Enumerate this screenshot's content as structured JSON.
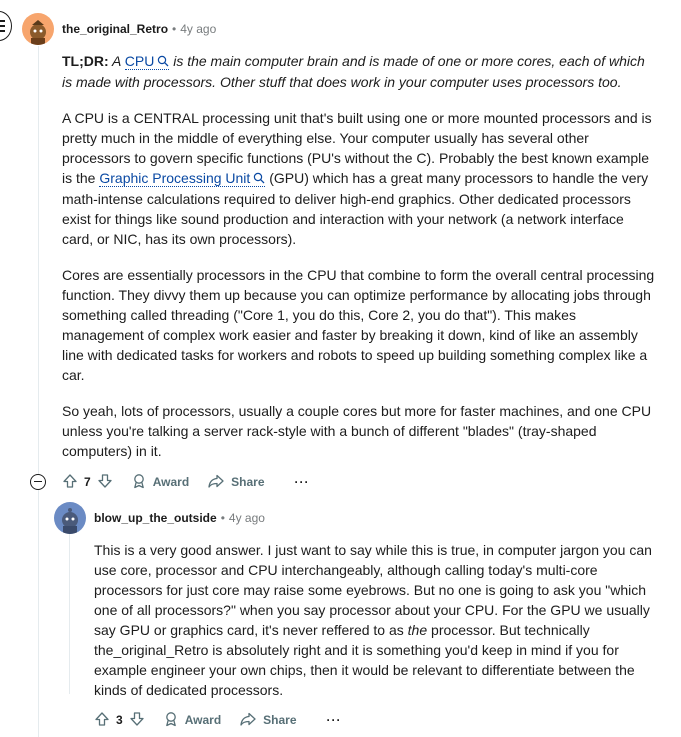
{
  "comment1": {
    "username": "the_original_Retro",
    "separator": "•",
    "age": "4y ago",
    "tldr_label": "TL;DR:",
    "tldr_pre": "A ",
    "tldr_keyword": "CPU",
    "tldr_post": " is the main computer brain and is made of one or more cores, each of which is made with processors. Other stuff that does work in your computer uses processors too.",
    "p2_pre": "A CPU is a CENTRAL processing unit that's built using one or more mounted processors and is pretty much in the middle of everything else. Your computer usually has several other processors to govern specific functions (PU's without the C). Probably the best known example is the ",
    "p2_keyword": "Graphic Processing Unit",
    "p2_post": " (GPU) which has a great many processors to handle the very math-intense calculations required to deliver high-end graphics. Other dedicated processors exist for things like sound production and interaction with your network (a network interface card, or NIC, has its own processors).",
    "p3": "Cores are essentially processors in the CPU that combine to form the overall central processing function. They divvy them up because you can optimize performance by allocating jobs through something called threading (\"Core 1, you do this, Core 2, you do that\"). This makes management of complex work easier and faster by breaking it down, kind of like an assembly line with dedicated tasks for workers and robots to speed up building something complex like a car.",
    "p4": "So yeah, lots of processors, usually a couple cores but more for faster machines, and one CPU unless you're talking a server rack-style with a bunch of different \"blades\" (tray-shaped computers) in it.",
    "votes": "7",
    "award_label": "Award",
    "share_label": "Share",
    "more_label": "···"
  },
  "comment2": {
    "username": "blow_up_the_outside",
    "separator": "•",
    "age": "4y ago",
    "text_pre": "This is a very good answer. I just want to say while this is true, in computer jargon you can use core, processor and CPU interchangeably, although calling today's multi-core processors for just core may raise some eyebrows. But no one is going to ask you \"which one of all processors?\" when you say processor about your CPU. For the GPU we usually say GPU or graphics card, it's never reffered to as ",
    "text_em": "the",
    "text_post": " processor. But technically the_original_Retro is absolutely right and it is something you'd keep in mind if you for example engineer your own chips, then it would be relevant to differentiate between the kinds of dedicated processors.",
    "votes": "3",
    "award_label": "Award",
    "share_label": "Share",
    "more_label": "···"
  },
  "colors": {
    "link": "#0a49a3",
    "meta": "#787c7e",
    "action": "#576f76",
    "thread_line": "#e5ebee",
    "avatar1_bg": "#f7a56d",
    "avatar2_bg": "#6b8bc4"
  }
}
